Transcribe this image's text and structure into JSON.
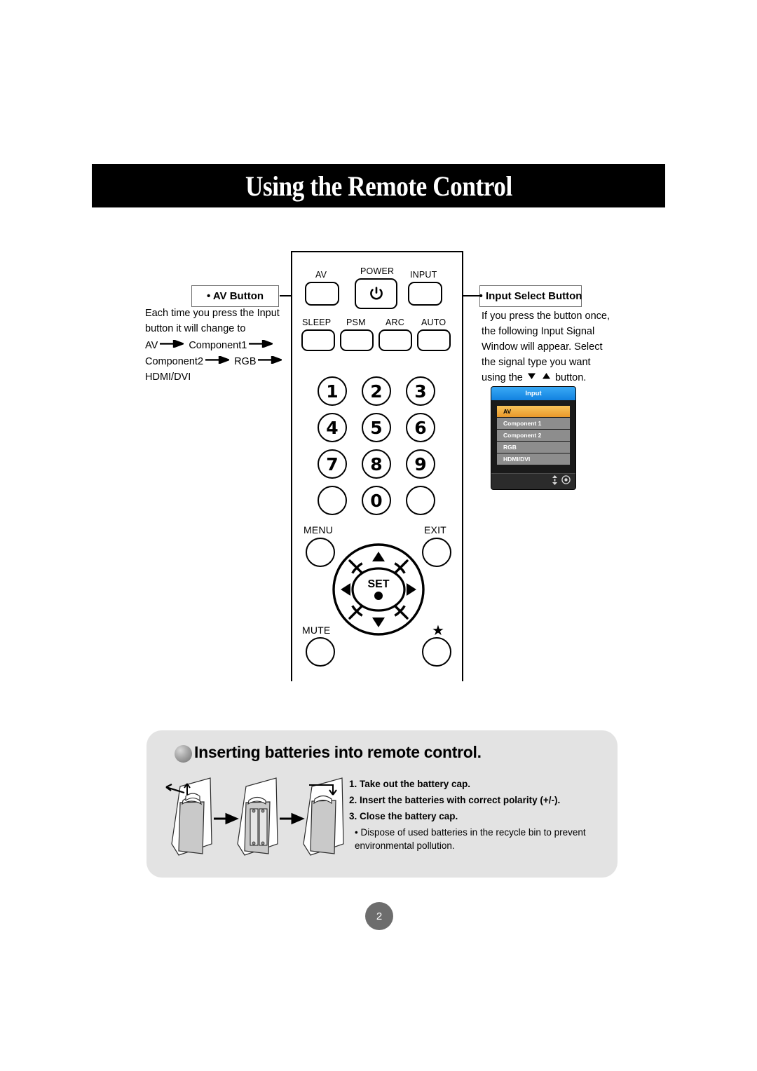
{
  "page": {
    "title": "Using the Remote Control",
    "number": "2"
  },
  "callouts": {
    "av": {
      "heading": "• AV Button",
      "line1": "Each time you press the Input",
      "line2": "button it will change to",
      "flow": [
        "AV",
        "Component1",
        "Component2",
        "RGB",
        "HDMI/DVI"
      ]
    },
    "input_select": {
      "heading": "• Input Select Button",
      "line1": "If you press the button once,",
      "line2": "the following Input Signal",
      "line3": "Window will appear. Select",
      "line4": "the signal type you want",
      "line5_pre": "using the",
      "line5_post": "button."
    }
  },
  "osd": {
    "title": "Input",
    "items": [
      {
        "label": "AV",
        "selected": true
      },
      {
        "label": "Component 1",
        "selected": false
      },
      {
        "label": "Component 2",
        "selected": false
      },
      {
        "label": "RGB",
        "selected": false
      },
      {
        "label": "HDMI/DVI",
        "selected": false
      }
    ],
    "footer_icons": [
      "updown-arrow-icon",
      "set-circle-icon"
    ],
    "colors": {
      "title_bar": "#1282e0",
      "selected": "#e9982a",
      "item": "#8d8d8d",
      "body": "#1a1a1a"
    }
  },
  "remote": {
    "row1": [
      {
        "label": "AV",
        "shape": "rounded"
      },
      {
        "label": "POWER",
        "shape": "rounded",
        "glyph": "power-icon"
      },
      {
        "label": "INPUT",
        "shape": "rounded"
      }
    ],
    "row2": [
      {
        "label": "SLEEP",
        "shape": "rounded"
      },
      {
        "label": "PSM",
        "shape": "rounded"
      },
      {
        "label": "ARC",
        "shape": "rounded"
      },
      {
        "label": "AUTO",
        "shape": "rounded"
      }
    ],
    "keypad": [
      "1",
      "2",
      "3",
      "4",
      "5",
      "6",
      "7",
      "8",
      "9",
      "",
      "0",
      ""
    ],
    "nav": {
      "menu": "MENU",
      "exit": "EXIT",
      "mute": "MUTE",
      "star": "★",
      "set": "SET",
      "directions": [
        "up-arrow-icon",
        "right-arrow-icon",
        "down-arrow-icon",
        "left-arrow-icon"
      ]
    }
  },
  "battery": {
    "title": "Inserting batteries into remote control.",
    "steps": [
      "1. Take out the battery cap.",
      "2. Insert the batteries with correct polarity (+/-).",
      "3. Close the battery cap."
    ],
    "note": "• Dispose of used batteries in the recycle bin to prevent environmental pollution."
  }
}
